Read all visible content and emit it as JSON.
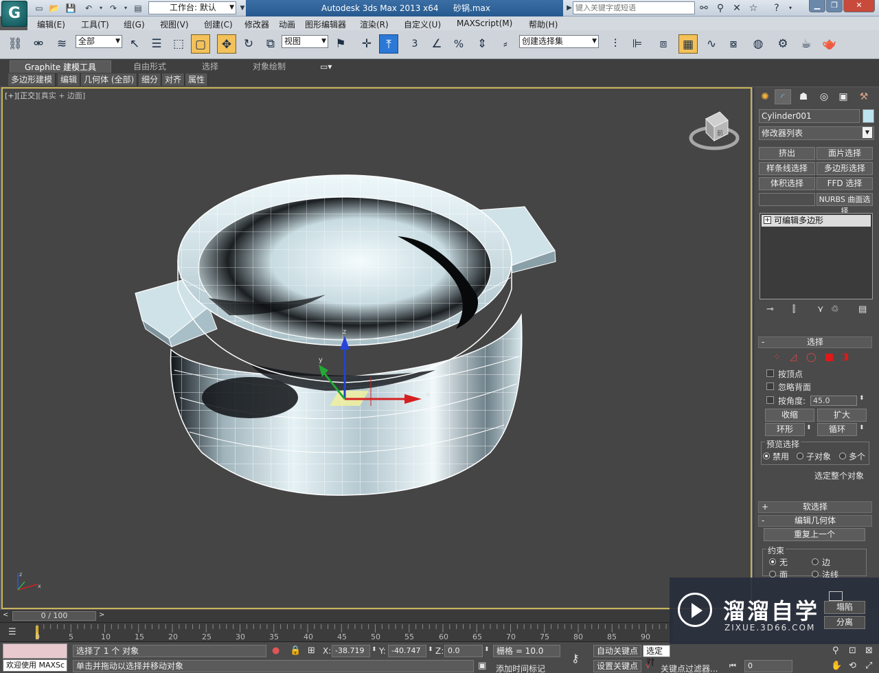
{
  "titlebar": {
    "logo": "G",
    "workspace": "工作台: 默认",
    "app_name": "Autodesk 3ds Max  2013 x64",
    "filename": "砂锅.max",
    "search_placeholder": "键入关键字或短语",
    "minimize": "▁",
    "restore": "❐",
    "close": "✕"
  },
  "menus": [
    "编辑(E)",
    "工具(T)",
    "组(G)",
    "视图(V)",
    "创建(C)",
    "修改器",
    "动画",
    "图形编辑器",
    "渲染(R)",
    "自定义(U)",
    "MAXScript(M)",
    "帮助(H)"
  ],
  "toolbar": {
    "selection_filter": "全部",
    "reference_coord": "视图",
    "named_selection": "创建选择集",
    "snap_3": "3",
    "percent_snap": "%"
  },
  "ribbon": {
    "tabs": [
      "Graphite 建模工具",
      "自由形式",
      "选择",
      "对象绘制"
    ],
    "subtabs": [
      "多边形建模",
      "编辑",
      "几何体 (全部)",
      "细分",
      "对齐",
      "属性"
    ]
  },
  "viewport": {
    "bracket": "[+]",
    "view": "[正交]",
    "shading": "[真实 + 边面]",
    "gizmo_x": "x",
    "gizmo_y": "y",
    "gizmo_z": "z",
    "cube_label": "前"
  },
  "command_panel": {
    "object_name": "Cylinder001",
    "object_color": "#bde3ee",
    "modifier_list": "修改器列表",
    "modifier_buttons": [
      "挤出",
      "面片选择",
      "样条线选择",
      "多边形选择",
      "体积选择",
      "FFD 选择",
      "",
      "NURBS 曲面选择"
    ],
    "stack_item": "可编辑多边形",
    "selection_rollout": {
      "title": "选择",
      "by_vertex": "按顶点",
      "ignore_backfacing": "忽略背面",
      "by_angle": "按角度:",
      "angle_value": "45.0",
      "shrink": "收缩",
      "grow": "扩大",
      "ring": "环形",
      "loop": "循环",
      "preview_label": "预览选择",
      "preview_off": "禁用",
      "preview_sub": "子对象",
      "preview_multi": "多个",
      "whole_object": "选定整个对象"
    },
    "soft_selection": "软选择",
    "edit_geometry": "编辑几何体",
    "repeat_last": "重复上一个",
    "constraints_label": "约束",
    "constraint_none": "无",
    "constraint_edge": "边",
    "constraint_face": "面",
    "constraint_normal": "法线",
    "collapse": "塌陷",
    "detach": "分离"
  },
  "timeline": {
    "frame_display": "0 / 100",
    "ticks": [
      "0",
      "5",
      "10",
      "15",
      "20",
      "25",
      "30",
      "35",
      "40",
      "45",
      "50",
      "55",
      "60",
      "65",
      "70",
      "75",
      "80",
      "85",
      "90"
    ]
  },
  "statusbar": {
    "maxscript": "欢迎使用 MAXSc",
    "selection_status": "选择了 1 个 对象",
    "prompt": "单击并拖动以选择并移动对象",
    "x_label": "X:",
    "x_value": "-38.719",
    "y_label": "Y:",
    "y_value": "-40.747",
    "z_label": "Z:",
    "z_value": "0.0",
    "grid": "栅格 = 10.0",
    "add_time_tag": "添加时间标记",
    "auto_key": "自动关键点",
    "set_key": "设置关键点",
    "selected": "选定对",
    "key_filters": "关键点过滤器...",
    "frame": "0"
  },
  "watermark": {
    "cn": "溜溜自学",
    "en": "ZIXUE.3D66.COM"
  }
}
